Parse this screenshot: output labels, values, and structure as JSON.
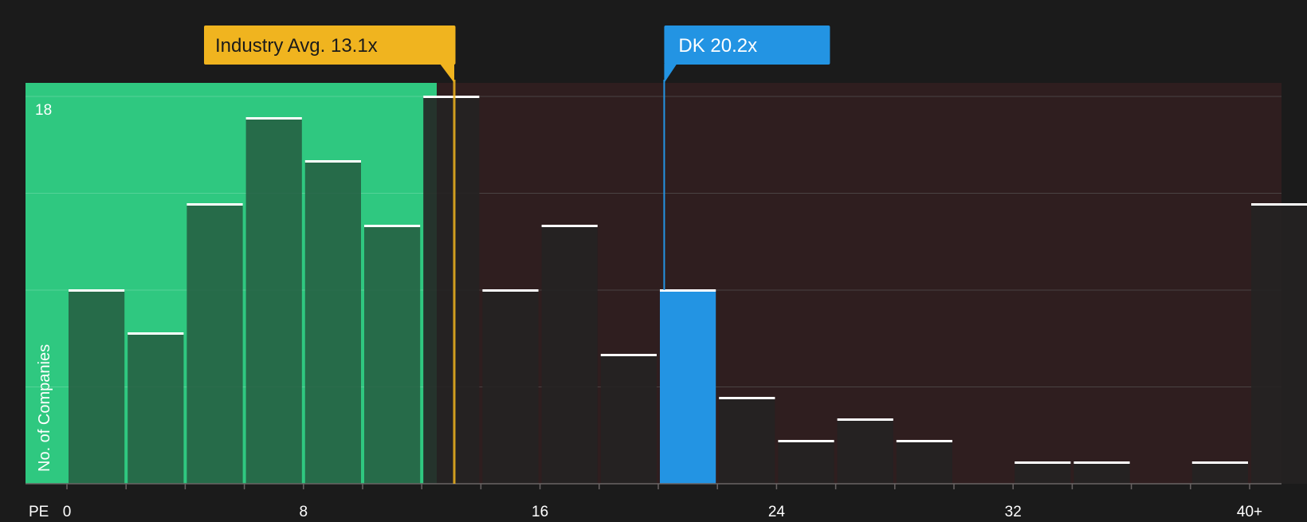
{
  "chart_data": {
    "type": "bar",
    "x_axis_label": "PE",
    "y_axis_label": "No. of Companies",
    "y_max_label": "18",
    "x_ticks": [
      "0",
      "8",
      "16",
      "24",
      "32",
      "40+"
    ],
    "bin_width": 2,
    "x_range": [
      0,
      40
    ],
    "y_range": [
      0,
      18
    ],
    "bins": [
      {
        "start": 0,
        "count": 9
      },
      {
        "start": 2,
        "count": 7
      },
      {
        "start": 4,
        "count": 13
      },
      {
        "start": 6,
        "count": 17
      },
      {
        "start": 8,
        "count": 15
      },
      {
        "start": 10,
        "count": 12
      },
      {
        "start": 12,
        "count": 18
      },
      {
        "start": 14,
        "count": 9
      },
      {
        "start": 16,
        "count": 12
      },
      {
        "start": 18,
        "count": 6
      },
      {
        "start": 20,
        "count": 9
      },
      {
        "start": 22,
        "count": 4
      },
      {
        "start": 24,
        "count": 2
      },
      {
        "start": 26,
        "count": 3
      },
      {
        "start": 28,
        "count": 2
      },
      {
        "start": 30,
        "count": 0
      },
      {
        "start": 32,
        "count": 1
      },
      {
        "start": 34,
        "count": 1
      },
      {
        "start": 36,
        "count": 0
      },
      {
        "start": 38,
        "count": 1
      },
      {
        "start": 40,
        "count": 13
      }
    ],
    "industry_avg": {
      "label": "Industry Avg. 13.1x",
      "value": 13.1
    },
    "company": {
      "label": "DK 20.2x",
      "value": 20.2
    },
    "colors": {
      "background": "#1b1b1b",
      "undervalued_zone": "#2fc880",
      "overvalued_zone": "#2f1e1f",
      "bar_in_green": "#245a3f",
      "bar_dark": "#252222",
      "highlight_bar": "#2394e3",
      "industry_marker": "#f0b41f",
      "company_marker": "#2394e3",
      "bar_cap": "#ffffff",
      "grid": "#4a4343",
      "text": "#ffffff",
      "industry_label_text": "#1b1b1b"
    }
  }
}
